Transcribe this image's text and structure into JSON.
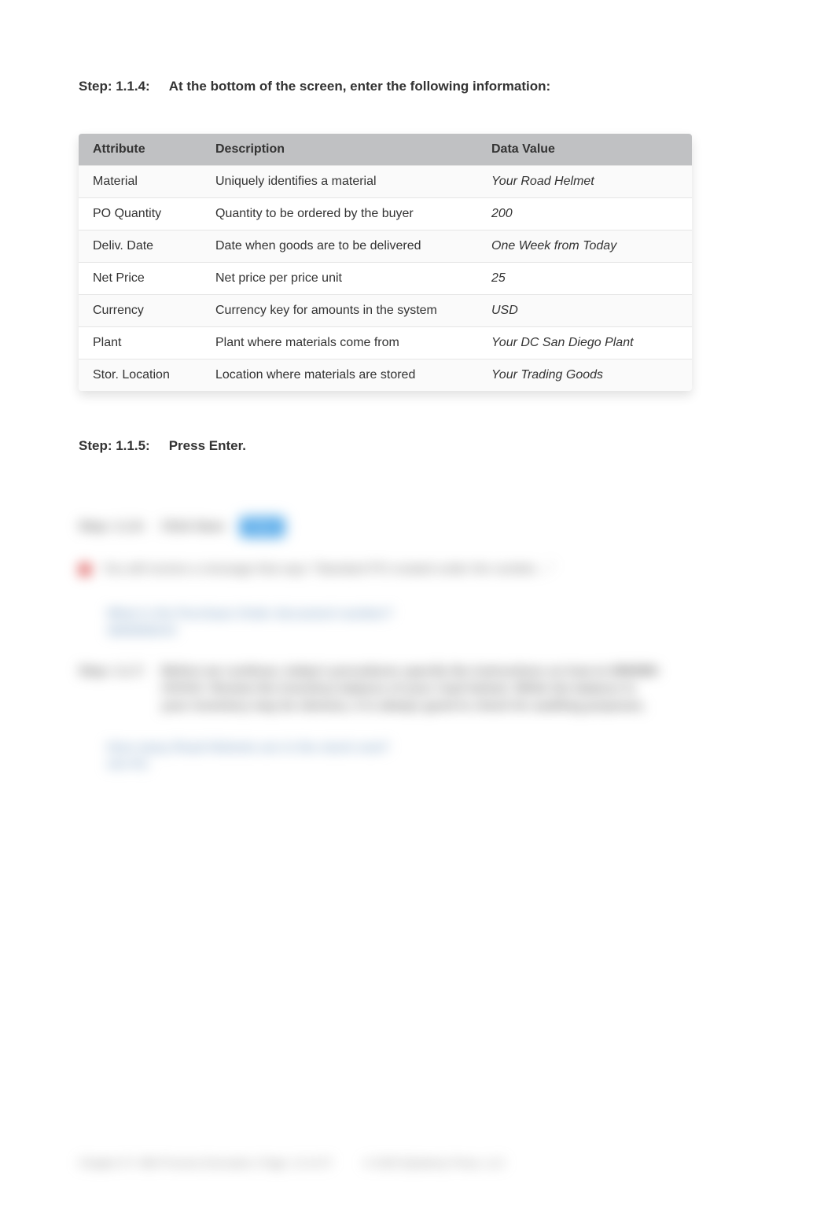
{
  "steps": {
    "s114": {
      "label": "Step: 1.1.4:",
      "text": "At the bottom of the screen, enter the following information:"
    },
    "s115": {
      "label": "Step: 1.1.5:",
      "text": "Press Enter."
    }
  },
  "table": {
    "headers": {
      "attribute": "Attribute",
      "description": "Description",
      "value": "Data Value"
    },
    "rows": [
      {
        "attr": "Material",
        "desc": "Uniquely identifies a material",
        "val": "Your Road Helmet"
      },
      {
        "attr": "PO Quantity",
        "desc": "Quantity to be ordered by the buyer",
        "val": "200"
      },
      {
        "attr": "Deliv. Date",
        "desc": "Date when goods are to be delivered",
        "val": "One Week from Today"
      },
      {
        "attr": "Net Price",
        "desc": "Net price per price unit",
        "val": "25"
      },
      {
        "attr": "Currency",
        "desc": "Currency key for amounts in the system",
        "val": "USD"
      },
      {
        "attr": "Plant",
        "desc": "Plant where materials come from",
        "val": "Your DC San Diego Plant"
      },
      {
        "attr": "Stor. Location",
        "desc": "Location where materials are stored",
        "val": "Your Trading Goods"
      }
    ]
  },
  "blurred": {
    "stepLabel": "Step: 1.1.6:",
    "stepAction": "Click Save",
    "badge": "Save",
    "notice": "You will receive a message that says \"Standard PO created under the number…\"",
    "q1a": "What is the Purchase Order document number?",
    "q1b": "4500000###",
    "stepLabel2": "Step: 1.1.7:",
    "longText": "Before we continue, today's procedures specify the instructions on how to MM/MM-######. Review the inventory balance of your road helmet. While the balance in your inventory may be obvious, it is always good to check for auditing purposes.",
    "q2a": "How many Road Helmets are in the stock now?",
    "q2b": "### PC",
    "footerLeft": "Chapter 07: MM Process Execution | Page: 12 of 27",
    "footerRight": "© 2020 Epistemy Press, LLC"
  }
}
